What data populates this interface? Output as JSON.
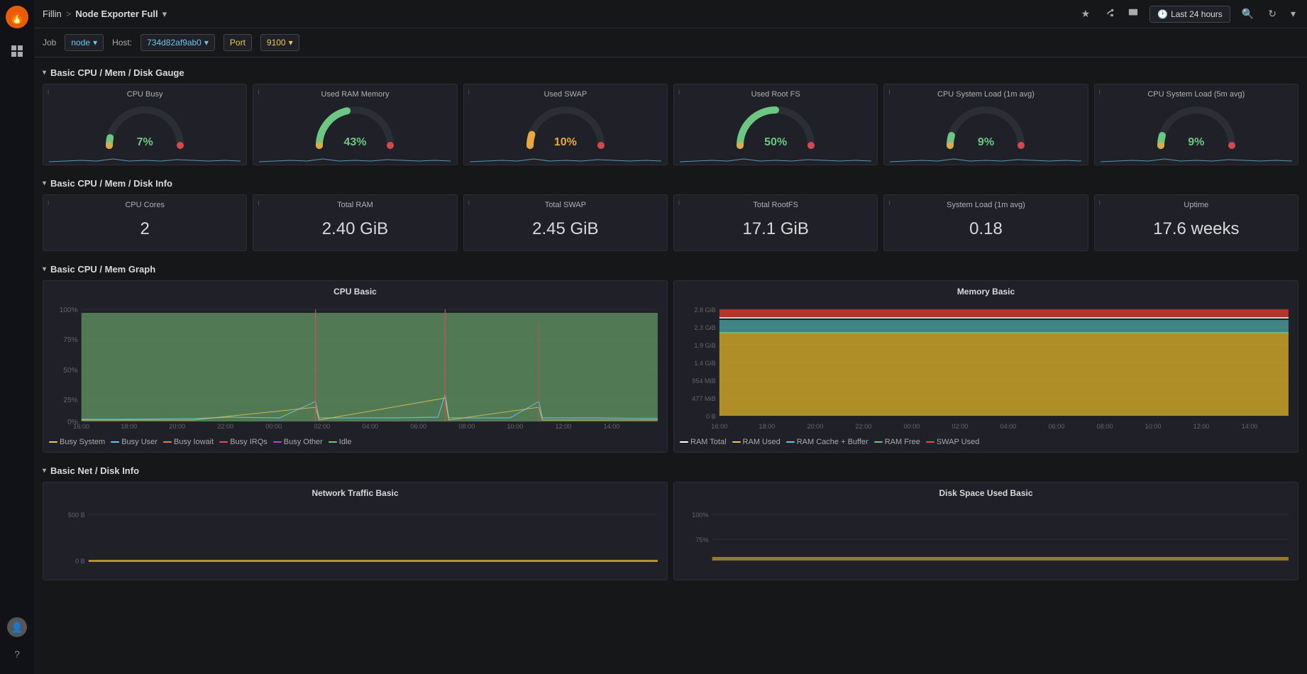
{
  "app": {
    "logo_label": "Grafana"
  },
  "breadcrumb": {
    "app_name": "Fillin",
    "separator": ">",
    "dashboard_name": "Node Exporter Full",
    "dropdown_icon": "▾"
  },
  "topbar": {
    "star_label": "★",
    "share_label": "⎋",
    "screen_label": "⬛",
    "time_range": "Last 24 hours",
    "search_label": "🔍",
    "refresh_label": "↻",
    "more_label": "▾"
  },
  "toolbar": {
    "job_label": "Job",
    "job_value": "node",
    "host_label": "Host:",
    "host_value": "734d82af9ab0",
    "port_label": "Port",
    "port_value": "9100"
  },
  "sections": {
    "basic_cpu_mem_disk_gauge": "Basic CPU / Mem / Disk Gauge",
    "basic_cpu_mem_disk_info": "Basic CPU / Mem / Disk Info",
    "basic_cpu_mem_graph": "Basic CPU / Mem Graph",
    "basic_net_disk_info": "Basic Net / Disk Info"
  },
  "gauges": [
    {
      "title": "CPU Busy",
      "value": "7%",
      "percent": 7,
      "color": "#6dc6e7"
    },
    {
      "title": "Used RAM Memory",
      "value": "43%",
      "percent": 43,
      "color": "#6dc6e7"
    },
    {
      "title": "Used SWAP",
      "value": "10%",
      "percent": 10,
      "color": "#e8a742"
    },
    {
      "title": "Used Root FS",
      "value": "50%",
      "percent": 50,
      "color": "#6dc6e7"
    },
    {
      "title": "CPU System Load (1m avg)",
      "value": "9%",
      "percent": 9,
      "color": "#6dc6e7"
    },
    {
      "title": "CPU System Load (5m avg)",
      "value": "9%",
      "percent": 9,
      "color": "#6dc6e7"
    }
  ],
  "info_panels": [
    {
      "title": "CPU Cores",
      "value": "2"
    },
    {
      "title": "Total RAM",
      "value": "2.40 GiB"
    },
    {
      "title": "Total SWAP",
      "value": "2.45 GiB"
    },
    {
      "title": "Total RootFS",
      "value": "17.1 GiB"
    },
    {
      "title": "System Load (1m avg)",
      "value": "0.18"
    },
    {
      "title": "Uptime",
      "value": "17.6 weeks"
    }
  ],
  "cpu_graph": {
    "title": "CPU Basic",
    "y_labels": [
      "100%",
      "75%",
      "50%",
      "25%",
      "0%"
    ],
    "x_labels": [
      "16:00",
      "18:00",
      "20:00",
      "22:00",
      "00:00",
      "02:00",
      "04:00",
      "06:00",
      "08:00",
      "10:00",
      "12:00",
      "14:00"
    ],
    "legend": [
      {
        "label": "Busy System",
        "color": "#e8ca52"
      },
      {
        "label": "Busy User",
        "color": "#6dc6e7"
      },
      {
        "label": "Busy Iowait",
        "color": "#e87d52"
      },
      {
        "label": "Busy IRQs",
        "color": "#e84b52"
      },
      {
        "label": "Busy Other",
        "color": "#b548c6"
      },
      {
        "label": "Idle",
        "color": "#6dc682"
      }
    ]
  },
  "memory_graph": {
    "title": "Memory Basic",
    "y_labels": [
      "2.8 GiB",
      "2.3 GiB",
      "1.9 GiB",
      "1.4 GiB",
      "954 MiB",
      "477 MiB",
      "0 B"
    ],
    "x_labels": [
      "16:00",
      "18:00",
      "20:00",
      "22:00",
      "00:00",
      "02:00",
      "04:00",
      "06:00",
      "08:00",
      "10:00",
      "12:00",
      "14:00"
    ],
    "legend": [
      {
        "label": "RAM Total",
        "color": "#ffffff"
      },
      {
        "label": "RAM Used",
        "color": "#e8ca52"
      },
      {
        "label": "RAM Cache + Buffer",
        "color": "#6dc6e7"
      },
      {
        "label": "RAM Free",
        "color": "#6dc682"
      },
      {
        "label": "SWAP Used",
        "color": "#e84b52"
      }
    ]
  },
  "net_graph": {
    "title": "Network Traffic Basic",
    "y_labels": [
      "500 B",
      "0 B"
    ]
  },
  "disk_graph": {
    "title": "Disk Space Used Basic",
    "y_labels": [
      "100%",
      "75%"
    ]
  }
}
